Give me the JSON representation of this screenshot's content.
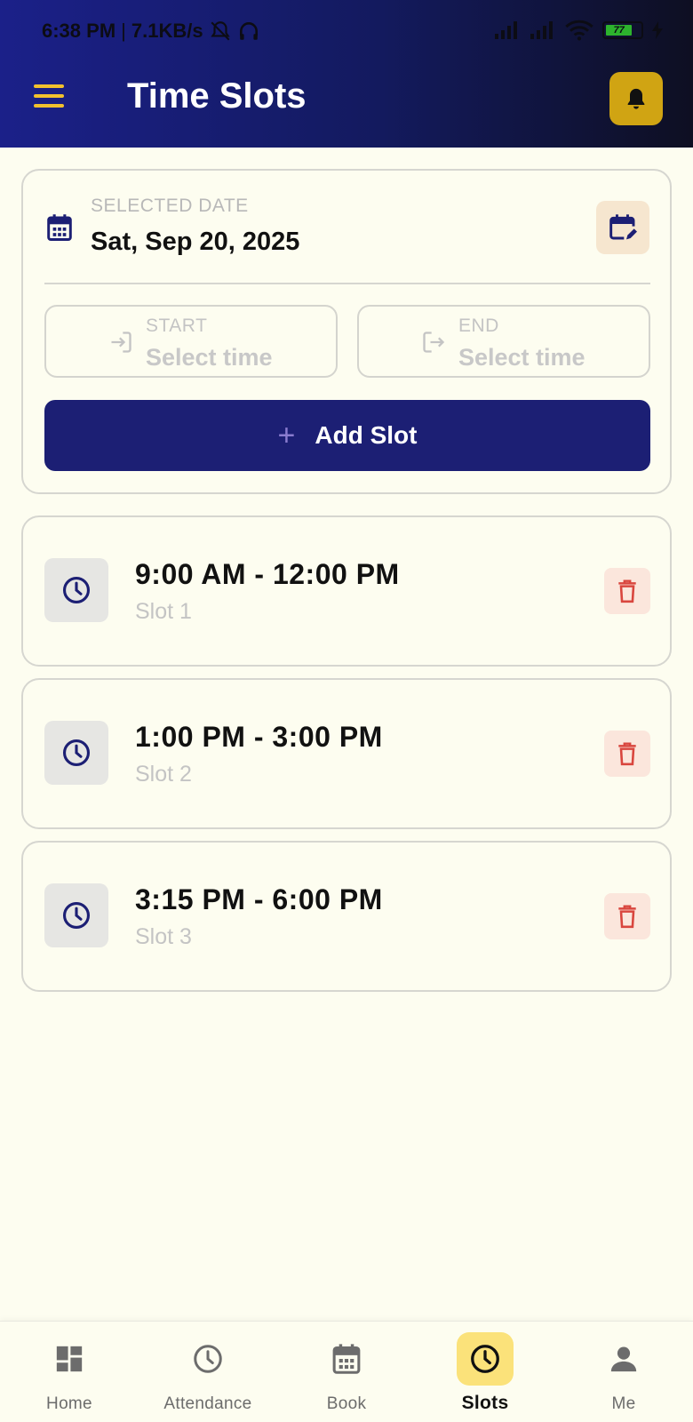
{
  "status_bar": {
    "time": "6:38 PM",
    "speed": "7.1KB/s",
    "battery": "77"
  },
  "header": {
    "title": "Time Slots"
  },
  "date_card": {
    "label": "SELECTED DATE",
    "value": "Sat, Sep 20, 2025",
    "start": {
      "label": "START",
      "placeholder": "Select time"
    },
    "end": {
      "label": "END",
      "placeholder": "Select time"
    },
    "add_button": {
      "icon": "+",
      "label": "Add Slot"
    }
  },
  "slots": [
    {
      "time": "9:00 AM - 12:00 PM",
      "name": "Slot 1"
    },
    {
      "time": "1:00 PM - 3:00 PM",
      "name": "Slot 2"
    },
    {
      "time": "3:15 PM - 6:00 PM",
      "name": "Slot 3"
    }
  ],
  "nav": [
    {
      "label": "Home",
      "icon": "dashboard-icon",
      "active": false
    },
    {
      "label": "Attendance",
      "icon": "clock-icon",
      "active": false
    },
    {
      "label": "Book",
      "icon": "calendar-icon",
      "active": false
    },
    {
      "label": "Slots",
      "icon": "clock-icon",
      "active": true
    },
    {
      "label": "Me",
      "icon": "person-icon",
      "active": false
    }
  ],
  "colors": {
    "header_start": "#1b2089",
    "header_end": "#0e0f22",
    "accent_yellow": "#f2c12e",
    "bell_bg": "#d0a413",
    "primary_button": "#1c1f74",
    "delete_icon": "#d9463e",
    "active_nav_bg": "#fbe27a",
    "background": "#fdfdf0"
  }
}
